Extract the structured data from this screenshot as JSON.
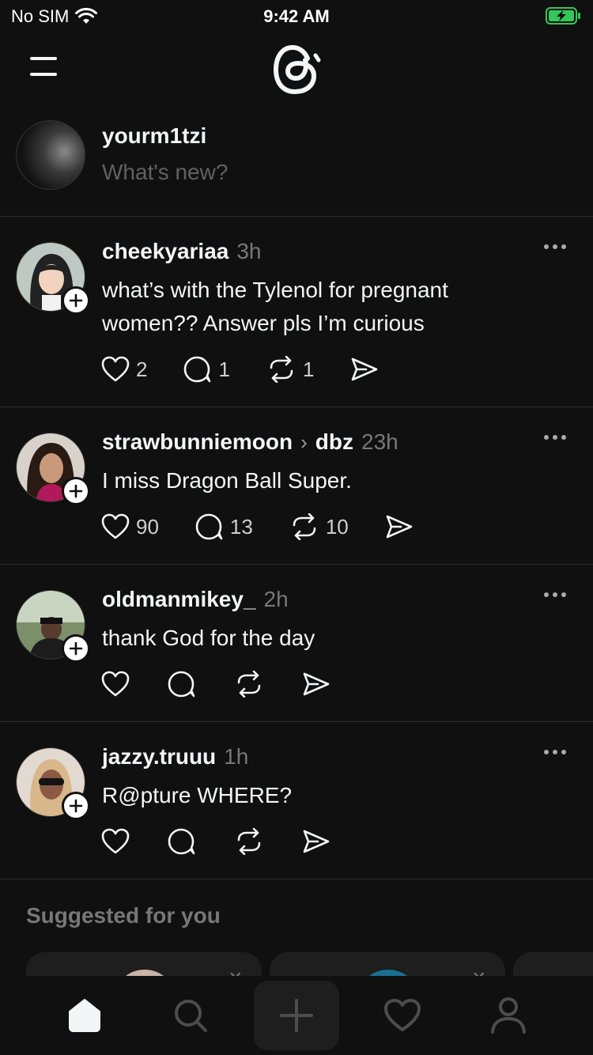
{
  "status_bar": {
    "carrier": "No SIM",
    "time": "9:42 AM"
  },
  "composer": {
    "username": "yourm1tzi",
    "placeholder": "What's new?"
  },
  "posts": [
    {
      "author": "cheekyariaa",
      "community": "",
      "time": "3h",
      "text": "what’s with the Tylenol for pregnant women?? Answer pls I’m curious",
      "likes": "2",
      "replies": "1",
      "reposts": "1"
    },
    {
      "author": "strawbunniemoon",
      "community": "dbz",
      "time": "23h",
      "text": "I miss Dragon Ball Super.",
      "likes": "90",
      "replies": "13",
      "reposts": "10"
    },
    {
      "author": "oldmanmikey_",
      "community": "",
      "time": "2h",
      "text": "thank God for the day",
      "likes": "",
      "replies": "",
      "reposts": ""
    },
    {
      "author": "jazzy.truuu",
      "community": "",
      "time": "1h",
      "text": "R@pture WHERE?",
      "likes": "",
      "replies": "",
      "reposts": ""
    }
  ],
  "suggested": {
    "title": "Suggested for you"
  },
  "icons": {
    "menu": "menu-icon",
    "logo": "threads-logo",
    "like": "heart-icon",
    "reply": "comment-icon",
    "repost": "repost-icon",
    "share": "send-icon",
    "more": "more-dots-icon",
    "home": "home-icon",
    "search": "search-icon",
    "create": "plus-icon",
    "activity": "heart-icon",
    "profile": "profile-icon"
  },
  "colors": {
    "background": "#101010",
    "text": "#f3f5f7",
    "muted": "#777777",
    "divider": "#2d2d2d",
    "battery": "#34c759"
  }
}
